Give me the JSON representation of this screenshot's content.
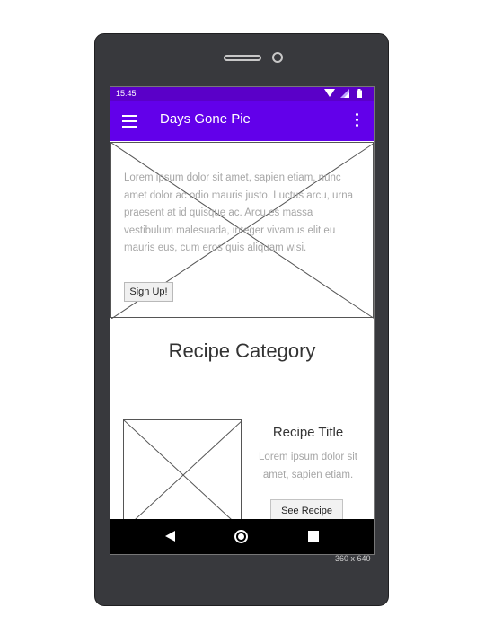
{
  "status_bar": {
    "time": "15:45"
  },
  "app_bar": {
    "title": "Days Gone Pie"
  },
  "hero": {
    "text": "Lorem ipsum dolor sit amet, sapien etiam, nunc amet dolor ac odio mauris justo. Luctus arcu, urna praesent at id quisque ac. Arcu es massa vestibulum malesuada, integer vivamus elit eu mauris eus, cum eros quis aliquam wisi.",
    "button_label": "Sign Up!"
  },
  "category": {
    "title": "Recipe Category"
  },
  "recipe": {
    "title": "Recipe Title",
    "description": "Lorem ipsum dolor sit amet, sapien etiam.",
    "button_label": "See Recipe"
  },
  "device": {
    "dimensions_label": "360 x 640"
  },
  "colors": {
    "status_bar": "#5a00c8",
    "app_bar": "#6200ea",
    "nav_bar": "#000000",
    "device_body": "#38393d"
  }
}
